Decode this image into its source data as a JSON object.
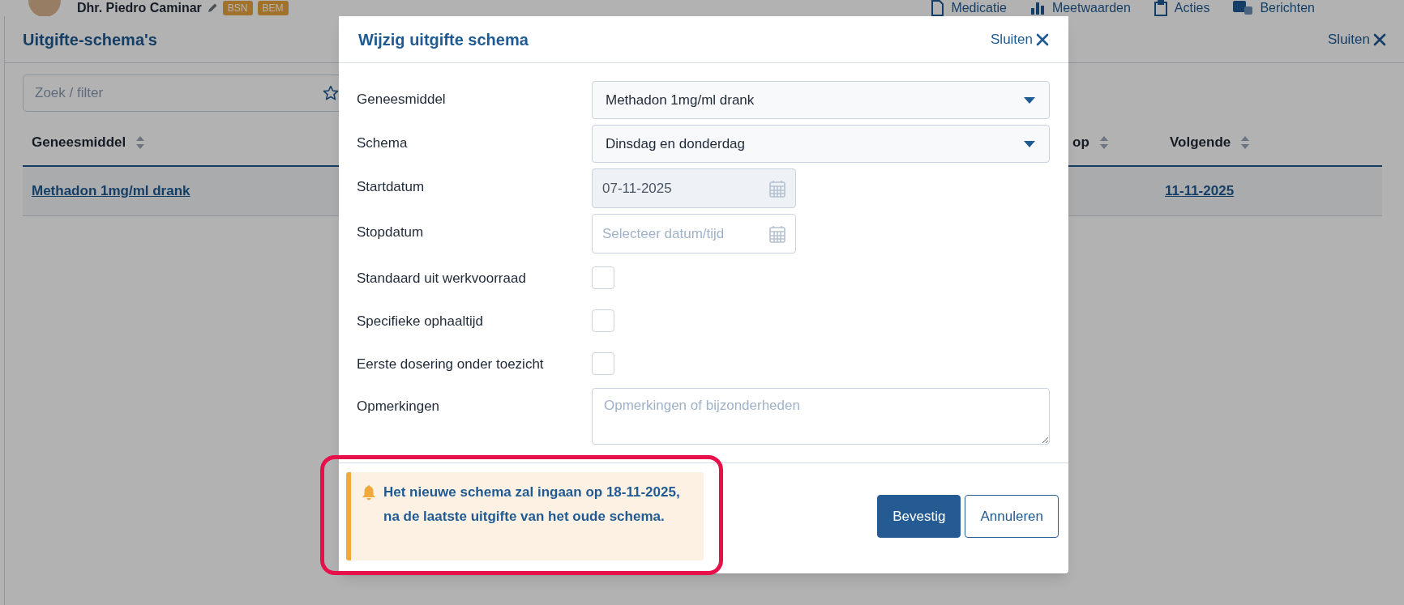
{
  "top_bar": {
    "patient_name": "Dhr. Piedro Caminar",
    "badges": [
      "BSN",
      "BEM"
    ],
    "nav": [
      {
        "label": "Medicatie",
        "kind": "document"
      },
      {
        "label": "Meetwaarden",
        "kind": "chart"
      },
      {
        "label": "Acties",
        "kind": "clipboard"
      },
      {
        "label": "Berichten",
        "kind": "chat"
      }
    ]
  },
  "panel": {
    "title": "Uitgifte-schema's",
    "close": "Sluiten",
    "search": {
      "placeholder": "Zoek / filter"
    },
    "table": {
      "columns": [
        "Geneesmiddel",
        "op",
        "Volgende"
      ],
      "rows": [
        {
          "cells": [
            "Methadon 1mg/ml drank",
            "",
            "11-11-2025"
          ]
        }
      ]
    }
  },
  "modal": {
    "title": "Wijzig uitgifte schema",
    "close": "Sluiten",
    "fields": [
      {
        "label": "Geneesmiddel",
        "kind": "select",
        "value": "Methadon 1mg/ml drank"
      },
      {
        "label": "Schema",
        "kind": "select",
        "value": "Dinsdag en donderdag"
      },
      {
        "label": "Startdatum",
        "kind": "date",
        "value": "07-11-2025",
        "disabled": true
      },
      {
        "label": "Stopdatum",
        "kind": "date",
        "placeholder": "Selecteer datum/tijd",
        "disabled": false
      },
      {
        "label": "Standaard uit werkvoorraad",
        "kind": "checkbox",
        "checked": false
      },
      {
        "label": "Specifieke ophaaltijd",
        "kind": "checkbox",
        "checked": false
      },
      {
        "label": "Eerste dosering onder toezicht",
        "kind": "checkbox",
        "checked": false
      },
      {
        "label": "Opmerkingen",
        "kind": "textarea",
        "placeholder": "Opmerkingen of bijzonderheden"
      }
    ],
    "alert": {
      "text": "Het nieuwe schema zal ingaan op 18-11-2025, na de laatste uitgifte van het oude schema.",
      "highlighted": true
    },
    "buttons": [
      {
        "label": "Bevestig",
        "kind": "primary"
      },
      {
        "label": "Annuleren",
        "kind": "secondary"
      }
    ]
  }
}
